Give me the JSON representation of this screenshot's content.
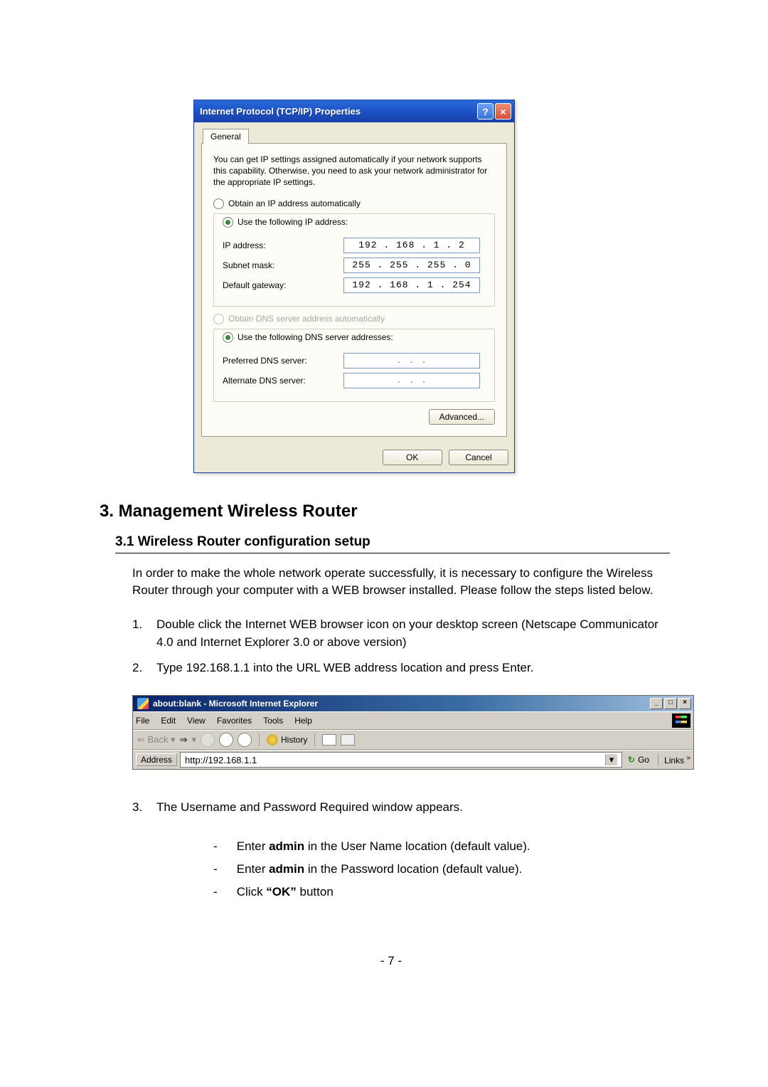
{
  "dialog": {
    "title": "Internet Protocol (TCP/IP) Properties",
    "tab": "General",
    "description": "You can get IP settings assigned automatically if your network supports this capability. Otherwise, you need to ask your network administrator for the appropriate IP settings.",
    "radio_obtain_ip": "Obtain an IP address automatically",
    "radio_use_ip": "Use the following IP address:",
    "ip_addr_label": "IP address:",
    "ip_addr_value": "192 . 168 .  1  .  2",
    "subnet_label": "Subnet mask:",
    "subnet_value": "255 . 255 . 255 .  0",
    "gateway_label": "Default gateway:",
    "gateway_value": "192 . 168 .  1  . 254",
    "radio_obtain_dns": "Obtain DNS server address automatically",
    "radio_use_dns": "Use the following DNS server addresses:",
    "pref_dns_label": "Preferred DNS server:",
    "pref_dns_value": ".       .       .",
    "alt_dns_label": "Alternate DNS server:",
    "alt_dns_value": ".       .       .",
    "advanced_btn": "Advanced...",
    "ok_btn": "OK",
    "cancel_btn": "Cancel"
  },
  "doc": {
    "h2": "3. Management Wireless Router",
    "h3": "3.1 Wireless Router configuration setup",
    "para": "In order to make the whole network operate successfully, it is necessary to configure the Wireless Router through your computer with a WEB browser installed. Please follow the steps listed below.",
    "step1_n": "1.",
    "step1": "Double click the Internet WEB browser icon on your desktop screen (Netscape Communicator 4.0 and Internet Explorer 3.0 or above version)",
    "step2_n": "2.",
    "step2": "Type 192.168.1.1 into the URL WEB address location and press Enter.",
    "step3_n": "3.",
    "step3": "The Username and Password Required window appears.",
    "sub_a_pre": "Enter ",
    "sub_a_bold": "admin",
    "sub_a_post": " in the User Name location (default value).",
    "sub_b_pre": "Enter ",
    "sub_b_bold": "admin",
    "sub_b_post": " in the Password location (default value).",
    "sub_c_pre": "Click ",
    "sub_c_bold": "“OK”",
    "sub_c_post": " button",
    "pagenum": "- 7 -"
  },
  "ie": {
    "title": "about:blank - Microsoft Internet Explorer",
    "menu": {
      "file": "File",
      "edit": "Edit",
      "view": "View",
      "fav": "Favorites",
      "tools": "Tools",
      "help": "Help"
    },
    "back": "Back",
    "history": "History",
    "address_label": "Address",
    "url": "http://192.168.1.1",
    "go": "Go",
    "links": "Links",
    "min": "_",
    "max": "□",
    "close": "×"
  }
}
